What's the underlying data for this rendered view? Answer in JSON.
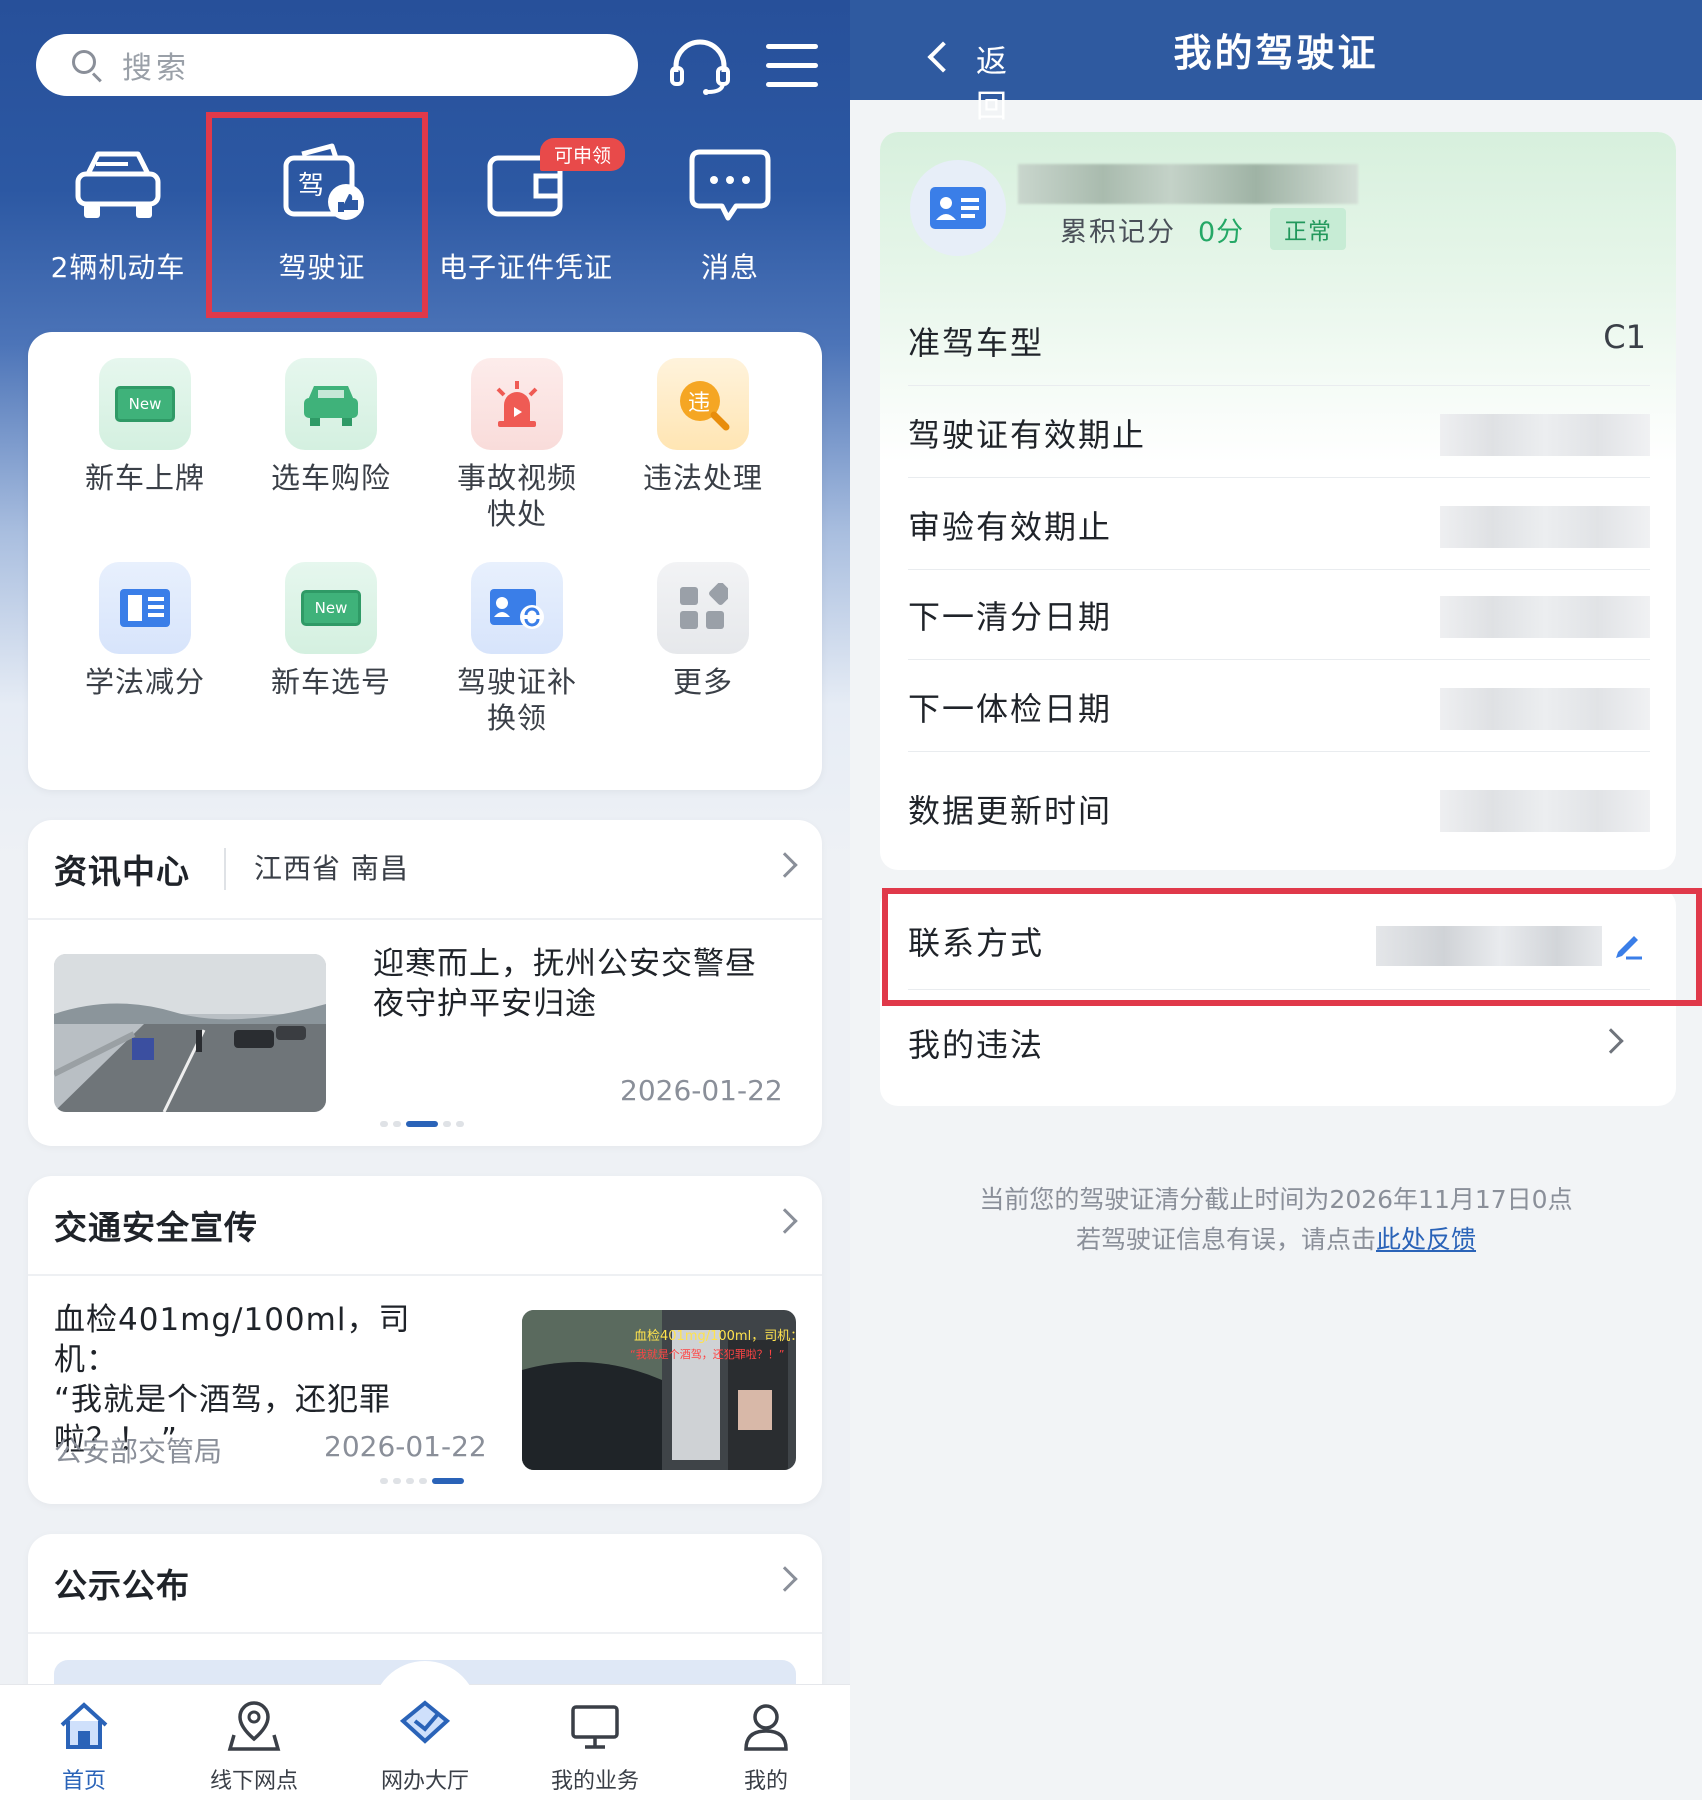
{
  "left": {
    "search": {
      "placeholder": "搜索"
    },
    "quick_actions": [
      {
        "label": "2辆机动车",
        "icon": "car-icon"
      },
      {
        "label": "驾驶证",
        "icon": "license-like-icon"
      },
      {
        "label": "电子证件凭证",
        "icon": "wallet-icon",
        "badge": "可申领"
      },
      {
        "label": "消息",
        "icon": "chat-bubble-icon"
      }
    ],
    "services": [
      {
        "label": "新车上牌",
        "icon": "new-plate-icon"
      },
      {
        "label": "选车购险",
        "icon": "car-insurance-icon"
      },
      {
        "label_1": "事故视频",
        "label_2": "快处",
        "icon": "siren-icon"
      },
      {
        "label": "违法处理",
        "icon": "violation-search-icon",
        "glyph": "违"
      },
      {
        "label": "学法减分",
        "icon": "book-icon"
      },
      {
        "label": "新车选号",
        "icon": "new-number-icon"
      },
      {
        "label_1": "驾驶证补",
        "label_2": "换领",
        "icon": "license-renew-icon"
      },
      {
        "label": "更多",
        "icon": "apps-grid-icon"
      }
    ],
    "new_chip": "New",
    "news": {
      "title": "资讯中心",
      "region": "江西省 南昌",
      "headline_1": "迎寒而上，抚州公安交警昼",
      "headline_2": "夜守护平安归途",
      "date": "2026-01-22"
    },
    "safety": {
      "title": "交通安全宣传",
      "headline_1": "血检401mg/100ml，司机：",
      "headline_2": "“我就是个酒驾，还犯罪",
      "headline_3": "啦？！ ”",
      "source": "公安部交管局",
      "date": "2026-01-22",
      "img_caption_1": "血检401mg/100ml，司机：",
      "img_caption_2": "“我就是个酒驾，还犯罪啦？！”"
    },
    "notice": {
      "title": "公示公布"
    },
    "tabbar": [
      {
        "label": "首页",
        "icon": "home-icon",
        "active": true
      },
      {
        "label": "线下网点",
        "icon": "map-pin-icon",
        "active": false
      },
      {
        "label": "网办大厅",
        "icon": "online-hall-icon",
        "active": false
      },
      {
        "label": "我的业务",
        "icon": "monitor-icon",
        "active": false
      },
      {
        "label": "我的",
        "icon": "user-icon",
        "active": false
      }
    ]
  },
  "right": {
    "back_label": "返回",
    "title": "我的驾驶证",
    "points_label": "累积记分",
    "points_value": "0分",
    "status": "正常",
    "rows": [
      {
        "label": "准驾车型",
        "value": "C1"
      },
      {
        "label": "驾驶证有效期止",
        "value": ""
      },
      {
        "label": "审验有效期止",
        "value": ""
      },
      {
        "label": "下一清分日期",
        "value": ""
      },
      {
        "label": "下一体检日期",
        "value": ""
      },
      {
        "label": "数据更新时间",
        "value": ""
      }
    ],
    "contact_label": "联系方式",
    "violations_label": "我的违法",
    "notice_line1": "当前您的驾驶证清分截止时间为2026年11月17日0点",
    "notice_line2_prefix": "若驾驶证信息有误，请点击",
    "notice_link": "此处反馈"
  },
  "colors": {
    "brand_blue": "#2f5aa0",
    "highlight_red": "#e0394a",
    "status_green": "#25a866",
    "link_blue": "#2a63b8"
  }
}
